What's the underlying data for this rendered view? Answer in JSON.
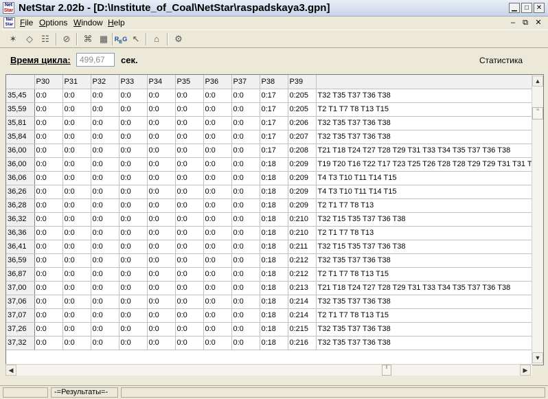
{
  "window": {
    "title": "NetStar 2.02b - [D:\\Institute_of_Coal\\NetStar\\raspadskaya3.gpn]",
    "icon_text_top": "Net",
    "icon_text_bottom": "Star"
  },
  "menu": {
    "items": [
      "File",
      "Options",
      "Window",
      "Help"
    ],
    "underline": [
      "F",
      "O",
      "W",
      "H"
    ]
  },
  "toolbar": {
    "icons": [
      "network-icon",
      "eraser-icon",
      "layers-icon",
      "compass-icon",
      "graph-icon",
      "calculator-icon",
      "regs-icon",
      "cursor-icon",
      "export-icon",
      "settings-icon"
    ]
  },
  "controls": {
    "cycle_label": "Время цикла:",
    "cycle_value": "499,67",
    "cycle_unit": "сек.",
    "statistics_link": "Статистика"
  },
  "table": {
    "columns": [
      "P30",
      "P31",
      "P32",
      "P33",
      "P34",
      "P35",
      "P36",
      "P37",
      "P38",
      "P39",
      ""
    ],
    "rows": [
      {
        "time": "35,45",
        "cells": [
          "0:0",
          "0:0",
          "0:0",
          "0:0",
          "0:0",
          "0:0",
          "0:0",
          "0:0",
          "0:17",
          "0:205"
        ],
        "path": "T32 T35 T37 T36 T38"
      },
      {
        "time": "35,59",
        "cells": [
          "0:0",
          "0:0",
          "0:0",
          "0:0",
          "0:0",
          "0:0",
          "0:0",
          "0:0",
          "0:17",
          "0:205"
        ],
        "path": "T2 T1 T7 T8 T13 T15"
      },
      {
        "time": "35,81",
        "cells": [
          "0:0",
          "0:0",
          "0:0",
          "0:0",
          "0:0",
          "0:0",
          "0:0",
          "0:0",
          "0:17",
          "0:206"
        ],
        "path": "T32 T35 T37 T36 T38"
      },
      {
        "time": "35,84",
        "cells": [
          "0:0",
          "0:0",
          "0:0",
          "0:0",
          "0:0",
          "0:0",
          "0:0",
          "0:0",
          "0:17",
          "0:207"
        ],
        "path": "T32 T35 T37 T36 T38"
      },
      {
        "time": "36,00",
        "cells": [
          "0:0",
          "0:0",
          "0:0",
          "0:0",
          "0:0",
          "0:0",
          "0:0",
          "0:0",
          "0:17",
          "0:208"
        ],
        "path": "T21 T18 T24 T27 T28 T29 T31 T33 T34 T35 T37 T36 T38"
      },
      {
        "time": "36,00",
        "cells": [
          "0:0",
          "0:0",
          "0:0",
          "0:0",
          "0:0",
          "0:0",
          "0:0",
          "0:0",
          "0:18",
          "0:209"
        ],
        "path": "T19 T20 T16 T22 T17 T23 T25 T26 T28 T28 T29 T29 T31 T31 T"
      },
      {
        "time": "36,06",
        "cells": [
          "0:0",
          "0:0",
          "0:0",
          "0:0",
          "0:0",
          "0:0",
          "0:0",
          "0:0",
          "0:18",
          "0:209"
        ],
        "path": "T4 T3 T10 T11 T14 T15"
      },
      {
        "time": "36,26",
        "cells": [
          "0:0",
          "0:0",
          "0:0",
          "0:0",
          "0:0",
          "0:0",
          "0:0",
          "0:0",
          "0:18",
          "0:209"
        ],
        "path": "T4 T3 T10 T11 T14 T15"
      },
      {
        "time": "36,28",
        "cells": [
          "0:0",
          "0:0",
          "0:0",
          "0:0",
          "0:0",
          "0:0",
          "0:0",
          "0:0",
          "0:18",
          "0:209"
        ],
        "path": "T2 T1 T7 T8 T13"
      },
      {
        "time": "36,32",
        "cells": [
          "0:0",
          "0:0",
          "0:0",
          "0:0",
          "0:0",
          "0:0",
          "0:0",
          "0:0",
          "0:18",
          "0:210"
        ],
        "path": "T32 T15 T35 T37 T36 T38"
      },
      {
        "time": "36,36",
        "cells": [
          "0:0",
          "0:0",
          "0:0",
          "0:0",
          "0:0",
          "0:0",
          "0:0",
          "0:0",
          "0:18",
          "0:210"
        ],
        "path": "T2 T1 T7 T8 T13"
      },
      {
        "time": "36,41",
        "cells": [
          "0:0",
          "0:0",
          "0:0",
          "0:0",
          "0:0",
          "0:0",
          "0:0",
          "0:0",
          "0:18",
          "0:211"
        ],
        "path": "T32 T15 T35 T37 T36 T38"
      },
      {
        "time": "36,59",
        "cells": [
          "0:0",
          "0:0",
          "0:0",
          "0:0",
          "0:0",
          "0:0",
          "0:0",
          "0:0",
          "0:18",
          "0:212"
        ],
        "path": "T32 T35 T37 T36 T38"
      },
      {
        "time": "36,87",
        "cells": [
          "0:0",
          "0:0",
          "0:0",
          "0:0",
          "0:0",
          "0:0",
          "0:0",
          "0:0",
          "0:18",
          "0:212"
        ],
        "path": "T2 T1 T7 T8 T13 T15"
      },
      {
        "time": "37,00",
        "cells": [
          "0:0",
          "0:0",
          "0:0",
          "0:0",
          "0:0",
          "0:0",
          "0:0",
          "0:0",
          "0:18",
          "0:213"
        ],
        "path": "T21 T18 T24 T27 T28 T29 T31 T33 T34 T35 T37 T36 T38"
      },
      {
        "time": "37,06",
        "cells": [
          "0:0",
          "0:0",
          "0:0",
          "0:0",
          "0:0",
          "0:0",
          "0:0",
          "0:0",
          "0:18",
          "0:214"
        ],
        "path": "T32 T35 T37 T36 T38"
      },
      {
        "time": "37,07",
        "cells": [
          "0:0",
          "0:0",
          "0:0",
          "0:0",
          "0:0",
          "0:0",
          "0:0",
          "0:0",
          "0:18",
          "0:214"
        ],
        "path": "T2 T1 T7 T8 T13 T15"
      },
      {
        "time": "37,26",
        "cells": [
          "0:0",
          "0:0",
          "0:0",
          "0:0",
          "0:0",
          "0:0",
          "0:0",
          "0:0",
          "0:18",
          "0:215"
        ],
        "path": "T32 T35 T37 T36 T38"
      },
      {
        "time": "37,32",
        "cells": [
          "0:0",
          "0:0",
          "0:0",
          "0:0",
          "0:0",
          "0:0",
          "0:0",
          "0:0",
          "0:18",
          "0:216"
        ],
        "path": "T32 T35 T37 T36 T38"
      }
    ]
  },
  "status": {
    "panel_left": "",
    "results_tab": "-=Результаты=-"
  },
  "colors": {
    "window_bg": "#ece9d8",
    "titlebar": "#dbe3f1",
    "grid_header": "#f0f0f0"
  }
}
